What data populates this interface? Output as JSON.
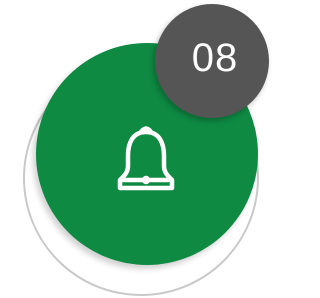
{
  "step_badge": {
    "number": "08"
  },
  "icon": {
    "name": "bell-icon"
  },
  "colors": {
    "circle": "#0e8a43",
    "badge": "#555555",
    "ring": "#c9c9c9",
    "icon_stroke": "#ffffff",
    "text": "#ffffff"
  }
}
